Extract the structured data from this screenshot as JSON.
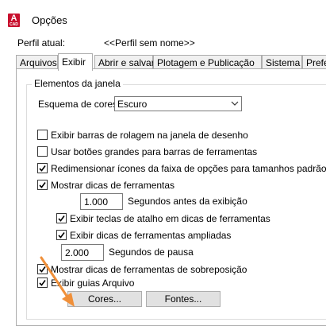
{
  "window": {
    "title": "Opções",
    "icon_letter": "A",
    "icon_sub": "CAD"
  },
  "profile": {
    "label": "Perfil atual:",
    "value": "<<Perfil sem nome>>"
  },
  "tabs": [
    {
      "label": "Arquivos"
    },
    {
      "label": "Exibir"
    },
    {
      "label": "Abrir e salvar"
    },
    {
      "label": "Plotagem e Publicação"
    },
    {
      "label": "Sistema"
    },
    {
      "label": "Preferê"
    }
  ],
  "active_tab": "Exibir",
  "group": {
    "title": "Elementos da janela",
    "scheme_label": "Esquema de cores:",
    "scheme_value": "Escuro"
  },
  "options": [
    {
      "label": "Exibir barras de rolagem na janela de desenho",
      "checked": false
    },
    {
      "label": "Usar botões grandes para barras de ferramentas",
      "checked": false
    },
    {
      "label": "Redimensionar ícones da faixa de opções para tamanhos padrão",
      "checked": true
    },
    {
      "label": "Mostrar dicas de ferramentas",
      "checked": true
    },
    {
      "label": "Exibir teclas de atalho em dicas de ferramentas",
      "checked": true
    },
    {
      "label": "Exibir dicas de ferramentas ampliadas",
      "checked": true
    },
    {
      "label": "Mostrar dicas de ferramentas de sobreposição",
      "checked": true
    },
    {
      "label": "Exibir guias Arquivo",
      "checked": true
    }
  ],
  "delay_before": {
    "value": "1.000",
    "label": "Segundos antes da exibição"
  },
  "delay_pause": {
    "value": "2.000",
    "label": "Segundos de pausa"
  },
  "buttons": {
    "colors": "Cores...",
    "fonts": "Fontes..."
  },
  "colors": {
    "accent_pointer": "#f0903a",
    "app_icon": "#c8102e"
  }
}
